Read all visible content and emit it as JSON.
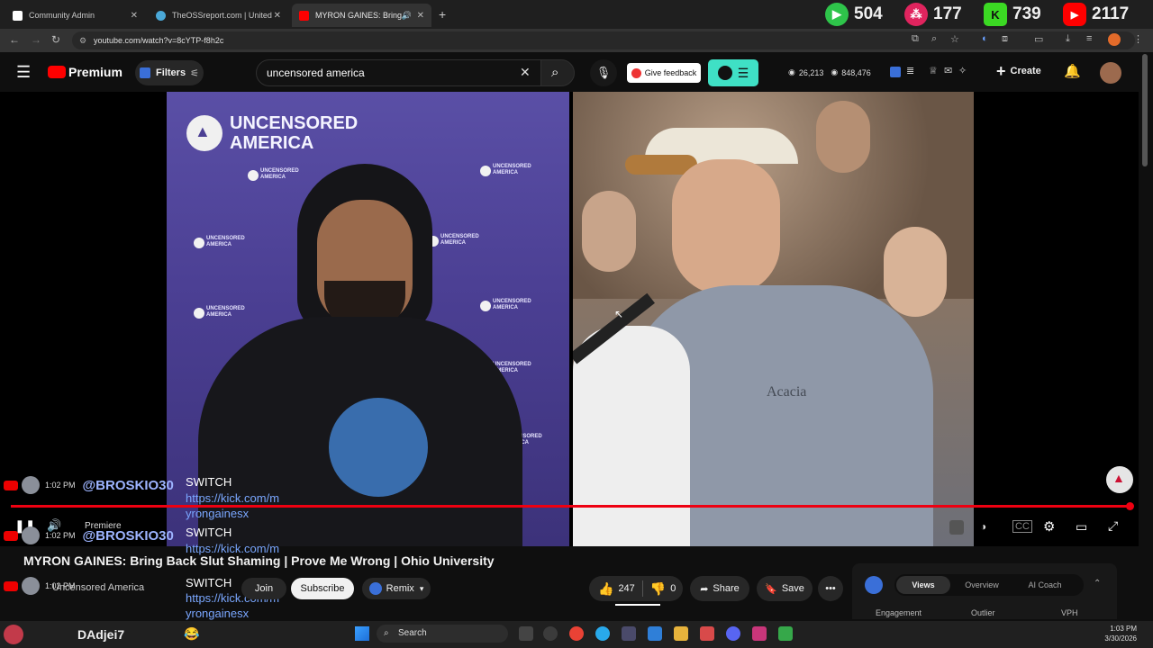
{
  "browser": {
    "tabs": [
      {
        "title": "Community Admin",
        "favicon_color": "#ffffff"
      },
      {
        "title": "TheOSSreport.com | United Sta",
        "favicon_color": "#4aa8d8"
      },
      {
        "title": "MYRON GAINES: Bring Back",
        "favicon_color": "#ff0000"
      }
    ],
    "new_tab": "+",
    "url": "youtube.com/watch?v=8cYTP-f8h2c"
  },
  "stream_counters": [
    {
      "icon": "rumble-icon",
      "value": "504",
      "color": "#2ec44a"
    },
    {
      "icon": "viewer-icon",
      "value": "177",
      "color": "#e0245e"
    },
    {
      "icon": "kick-icon",
      "value": "739",
      "color": "#3bd923"
    },
    {
      "icon": "youtube-icon",
      "value": "2117",
      "color": "#ff0000"
    }
  ],
  "youtube": {
    "brand": "Premium",
    "filters_label": "Filters",
    "search_value": "uncensored america",
    "feedback_label": "Give feedback",
    "stat_a": "26,213",
    "stat_b": "848,476",
    "create_label": "Create"
  },
  "video": {
    "left_banner_top": "UNCENSORED",
    "left_banner_bottom": "AMERICA",
    "left_tile_top": "UNCENSORED",
    "left_tile_bottom": "AMERICA",
    "shirt_text": "Acacia",
    "premiere_label": "Premiere",
    "title": "MYRON GAINES: Bring Back Slut Shaming | Prove Me Wrong | Ohio University"
  },
  "chat": [
    {
      "time": "1:02 PM",
      "handle": "@BROSKIO30",
      "command": "SWITCH",
      "link1": "https://kick.com/m",
      "link2": "yrongainesx"
    },
    {
      "time": "1:02 PM",
      "handle": "@BROSKIO30",
      "command": "SWITCH",
      "link1": "https://kick.com/m",
      "link2": ""
    },
    {
      "time": "1:02 PM",
      "handle": "",
      "command": "SWITCH",
      "link1": "https://kick.com/m",
      "link2": "yrongainesx"
    }
  ],
  "channel": {
    "name": "Uncensored America",
    "join_label": "Join",
    "subscribe_label": "Subscribe",
    "remix_label": "Remix",
    "likes": "247",
    "dislikes": "0",
    "share_label": "Share",
    "save_label": "Save"
  },
  "iq_panel": {
    "tabs": [
      "Views",
      "Overview",
      "AI Coach"
    ],
    "columns": [
      "Engagement",
      "Outlier",
      "VPH"
    ]
  },
  "taskbar": {
    "user": "DAdjei7",
    "search_label": "Search",
    "time": "1:03 PM",
    "date": "3/30/2026"
  }
}
